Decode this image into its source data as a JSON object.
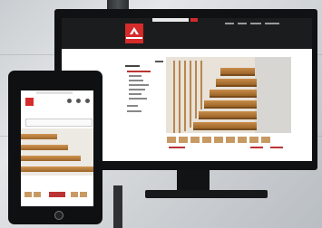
{
  "scene": {
    "description_tags": [
      "desktop-monitor",
      "tablet",
      "staircase-website"
    ],
    "brand_color": "#d52b2b",
    "monitor_color": "#101113",
    "wood_color": "#c98d4a"
  },
  "icons": {
    "logo": "brand-logo-icon",
    "search": "search-icon",
    "home": "home-button-icon"
  }
}
